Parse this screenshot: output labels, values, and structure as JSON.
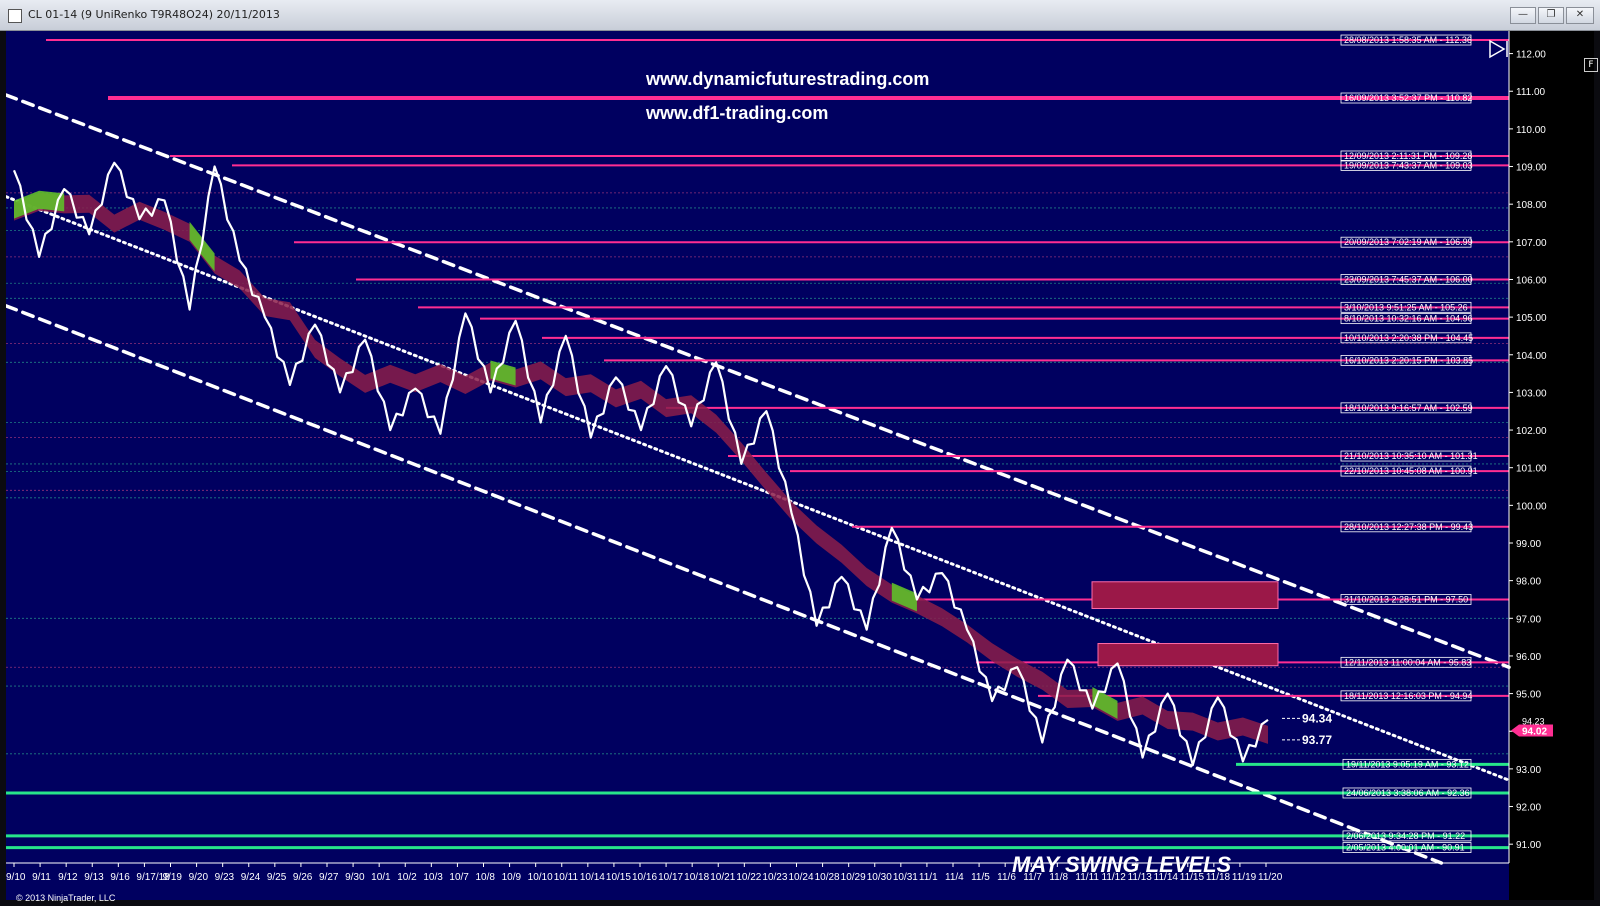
{
  "window": {
    "title": "CL 01-14 (9 UniRenko T9R48O24)  20/11/2013",
    "buttons": {
      "minimize": "—",
      "maximize": "❐",
      "close": "✕"
    }
  },
  "header_links": [
    "www.dynamicfuturestrading.com",
    "www.df1-trading.com"
  ],
  "annotation": "MAY SWING LEVELS",
  "copyright": "© 2013 NinjaTrader, LLC",
  "corner_button": "F",
  "colors": {
    "background": "#000060",
    "resistance": "#ff2e92",
    "support": "#27e68a",
    "price": "#ffffff",
    "ribbon_bear": "#8b1d4a",
    "ribbon_bull": "#5fbf2a",
    "last_price": "#ff2e92"
  },
  "chart_data": {
    "type": "line",
    "instrument": "CL 01-14",
    "y_axis": {
      "min": 90.5,
      "max": 112.6,
      "ticks": [
        "112.00",
        "111.00",
        "110.00",
        "109.00",
        "108.00",
        "107.00",
        "106.00",
        "105.00",
        "104.00",
        "103.00",
        "102.00",
        "101.00",
        "100.00",
        "99.00",
        "98.00",
        "97.00",
        "96.00",
        "95.00",
        "94.00",
        "93.00",
        "92.00",
        "91.00"
      ]
    },
    "x_ticks": [
      "9/10",
      "9/11",
      "9/12",
      "9/13",
      "9/16",
      "9/17/18",
      "9/19",
      "9/20",
      "9/23",
      "9/24",
      "9/25",
      "9/26",
      "9/27",
      "9/30",
      "10/1",
      "10/2",
      "10/3",
      "10/7",
      "10/8",
      "10/9",
      "10/10",
      "10/11",
      "10/14",
      "10/15",
      "10/16",
      "10/17",
      "10/18",
      "10/21",
      "10/22",
      "10/23",
      "10/24",
      "10/28",
      "10/29",
      "10/30",
      "10/31",
      "11/1",
      "11/4",
      "11/5",
      "11/6",
      "11/7",
      "11/8",
      "11/11",
      "11/12",
      "11/13",
      "11/14",
      "11/15",
      "11/18",
      "11/19",
      "11/20"
    ],
    "price_path": [
      108.9,
      106.6,
      108.4,
      107.2,
      109.1,
      107.6,
      108.1,
      105.2,
      109.0,
      106.5,
      105.0,
      103.2,
      104.8,
      103.0,
      104.4,
      102.0,
      103.1,
      101.9,
      105.1,
      103.0,
      104.9,
      102.2,
      104.5,
      101.8,
      103.4,
      102.0,
      103.7,
      102.1,
      103.8,
      101.1,
      102.5,
      99.8,
      96.8,
      98.1,
      96.7,
      99.4,
      97.5,
      98.2,
      96.7,
      94.8,
      95.7,
      93.7,
      95.9,
      94.6,
      95.8,
      93.3,
      95.0,
      93.1,
      94.9,
      93.2,
      94.3
    ],
    "resistance_levels": [
      {
        "label": "28/08/2013 1:58:35 AM - 112.36",
        "price": 112.36
      },
      {
        "label": "16/09/2013 3:52:37 PM - 110.82",
        "price": 110.82
      },
      {
        "label": "12/09/2013 2:11:31 PM - 109.28",
        "price": 109.28
      },
      {
        "label": "19/09/2013 7:43:37 AM - 109.03",
        "price": 109.03
      },
      {
        "label": "20/09/2013 7:02:19 AM - 106.99",
        "price": 106.99
      },
      {
        "label": "23/09/2013 7:45:37 AM - 106.00",
        "price": 106.0
      },
      {
        "label": "3/10/2013 9:51:25 AM - 105.26",
        "price": 105.26
      },
      {
        "label": "8/10/2013 10:32:16 AM - 104.96",
        "price": 104.96
      },
      {
        "label": "10/10/2013 2:20:38 PM - 104.45",
        "price": 104.45
      },
      {
        "label": "16/10/2013 2:20:15 PM - 103.85",
        "price": 103.85
      },
      {
        "label": "18/10/2013 9:16:57 AM - 102.59",
        "price": 102.59
      },
      {
        "label": "21/10/2013 10:35:10 AM - 101.31",
        "price": 101.31
      },
      {
        "label": "22/10/2013 10:45:08 AM - 100.91",
        "price": 100.91
      },
      {
        "label": "28/10/2013 12:27:38 PM - 99.43",
        "price": 99.43
      },
      {
        "label": "31/10/2013 2:28:51 PM - 97.50",
        "price": 97.5
      },
      {
        "label": "12/11/2013 11:00:04 AM - 95.83",
        "price": 95.83
      },
      {
        "label": "18/11/2013 12:16:03 PM - 94.94",
        "price": 94.94
      }
    ],
    "support_levels": [
      {
        "label": "19/11/2013 9:05:19 AM - 93.12",
        "price": 93.12
      },
      {
        "label": "24/06/2013 3:38:06 AM - 92.36",
        "price": 92.36
      },
      {
        "label": "2/06/2013 9:34:28 PM - 91.22",
        "price": 91.22
      },
      {
        "label": "2/05/2013 4:00:01 AM - 90.91",
        "price": 90.91
      }
    ],
    "price_marks": [
      {
        "label": "94.34",
        "price": 94.34
      },
      {
        "label": "93.77",
        "price": 93.77
      }
    ],
    "last_price": "94.02",
    "prev_price": "94.23",
    "supply_zones": [
      {
        "top": 97.97,
        "bottom": 97.26
      },
      {
        "top": 96.33,
        "bottom": 95.74
      }
    ],
    "channel_lines": [
      {
        "style": "dashed",
        "from": [
          0,
          110.9
        ],
        "to": [
          1,
          95.7
        ]
      },
      {
        "style": "dashed",
        "from": [
          0,
          105.3
        ],
        "to": [
          0.955,
          90.5
        ]
      },
      {
        "style": "dotted",
        "from": [
          0,
          108.2
        ],
        "to": [
          1,
          92.7
        ]
      }
    ]
  }
}
